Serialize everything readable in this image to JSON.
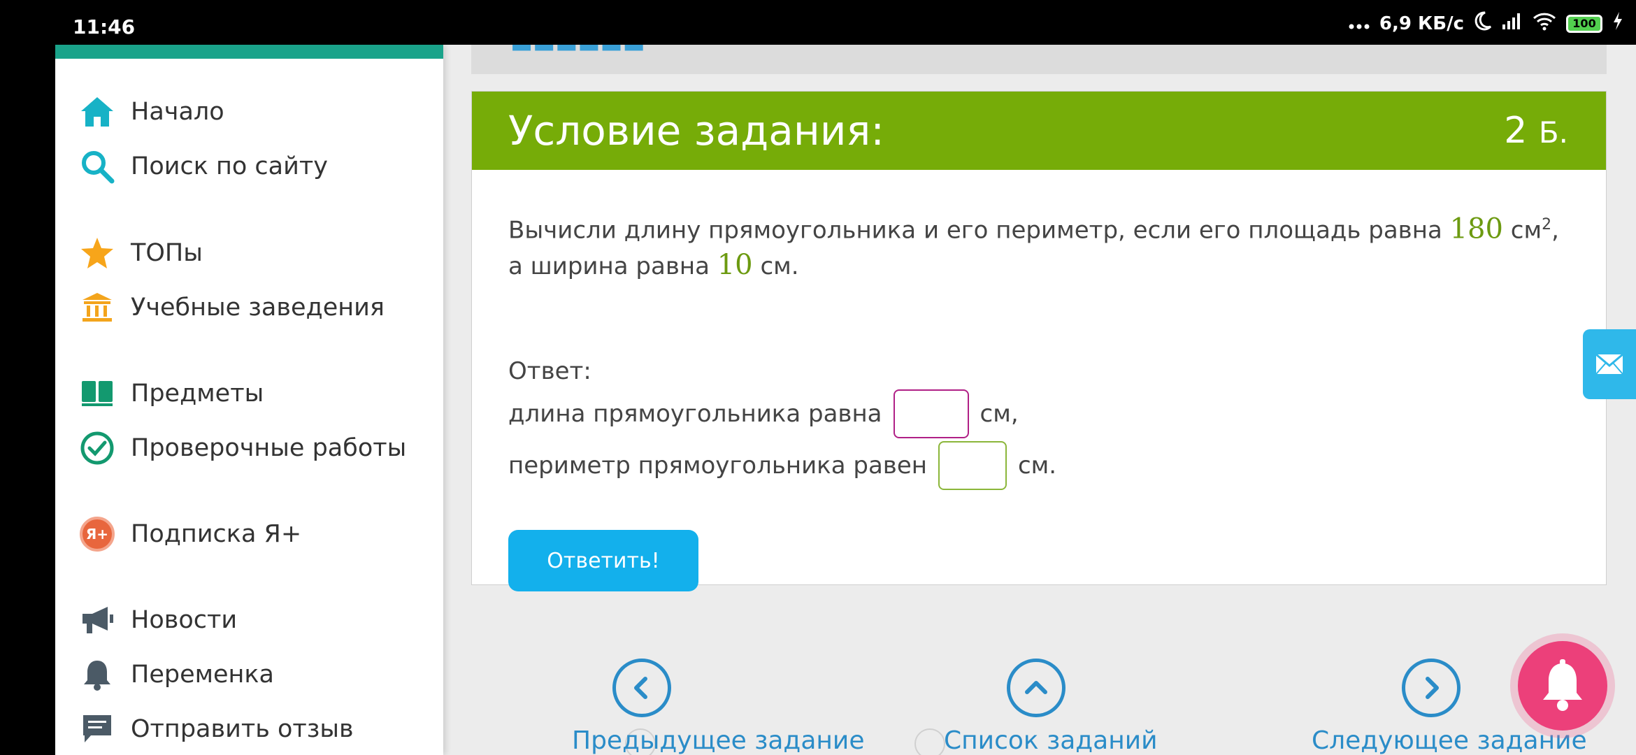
{
  "statusbar": {
    "time": "11:46",
    "net_speed": "6,9 КБ/с",
    "battery": "100",
    "icons": [
      "dots-icon",
      "moon-icon",
      "signal-icon",
      "wifi-icon",
      "battery-icon",
      "charging-icon"
    ]
  },
  "sidebar": {
    "items": [
      {
        "label": "Начало",
        "icon": "home-icon"
      },
      {
        "label": "Поиск по сайту",
        "icon": "search-icon"
      },
      {
        "label": "ТОПы",
        "icon": "star-icon"
      },
      {
        "label": "Учебные заведения",
        "icon": "institution-icon"
      },
      {
        "label": "Предметы",
        "icon": "books-icon"
      },
      {
        "label": "Проверочные работы",
        "icon": "check-circle-icon"
      },
      {
        "label": "Подписка Я+",
        "icon": "subscription-icon"
      },
      {
        "label": "Новости",
        "icon": "megaphone-icon"
      },
      {
        "label": "Переменка",
        "icon": "bell-icon"
      },
      {
        "label": "Отправить отзыв",
        "icon": "feedback-icon"
      }
    ],
    "accent_color": "#1aa38a"
  },
  "task": {
    "header_title": "Условие задания:",
    "points_value": "2",
    "points_unit": "Б.",
    "question_part1": "Вычисли длину прямоугольника и его периметр, если его площадь равна ",
    "area_value": "180",
    "area_unit": " см",
    "area_exp": "2",
    "question_part2": ", а ширина равна ",
    "width_value": "10",
    "question_part3": " см.",
    "answer_label": "Ответ:",
    "row1_label": "длина прямоугольника равна",
    "row1_value": "",
    "row1_unit": "см,",
    "row2_label": "периметр прямоугольника равен",
    "row2_value": "",
    "row2_unit": "см.",
    "submit_label": "Ответить!",
    "header_color": "#76ac08"
  },
  "bottom_nav": {
    "prev_label": "Предыдущее задание",
    "list_label": "Список заданий",
    "next_label": "Следующее задание",
    "color": "#2a8cc8"
  }
}
